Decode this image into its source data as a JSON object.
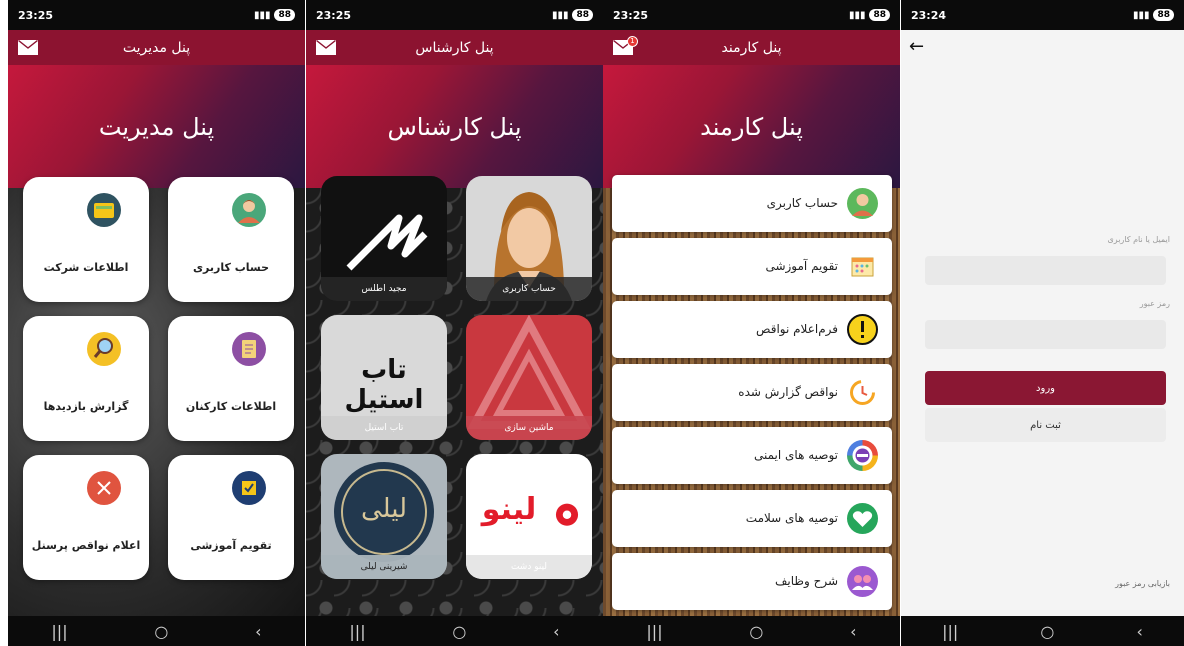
{
  "status_times": [
    "23:25",
    "23:25",
    "23:25",
    "23:24"
  ],
  "battery": "88",
  "colors": {
    "primary": "#8c1330",
    "hero_start": "#c5183c",
    "hero_end": "#2b1740",
    "login_btn": "#8a1733"
  },
  "nav_icons": [
    "recent-apps-icon",
    "home-icon",
    "back-icon"
  ],
  "admin": {
    "appbar_title": "پنل مدیریت",
    "hero_title": "پنل مدیریت",
    "tiles": [
      {
        "label": "حساب کاربری",
        "icon": "user-avatar-icon"
      },
      {
        "label": "اطلاعات شرکت",
        "icon": "folder-icon"
      },
      {
        "label": "اطلاعات کارکنان",
        "icon": "id-card-icon"
      },
      {
        "label": "گزارش بازدیدها",
        "icon": "magnifier-icon"
      },
      {
        "label": "تقویم آموزشی",
        "icon": "calendar-check-icon"
      },
      {
        "label": "اعلام نواقص پرسنل",
        "icon": "close-circle-icon"
      }
    ]
  },
  "expert": {
    "appbar_title": "پنل کارشناس",
    "hero_title": "پنل کارشناس",
    "cards": [
      {
        "label": "حساب کاربری",
        "icon": "woman-avatar-icon"
      },
      {
        "label": "مجید اطلس",
        "logo_text": ""
      },
      {
        "label": "ماشین سازی",
        "icon": "triangle-logo-icon"
      },
      {
        "label": "تاب استیل",
        "logo_text": "تاب استیل"
      },
      {
        "label": "لینو دشت",
        "logo_text": "لینو"
      },
      {
        "label": "شیرینی لیلی",
        "logo_text": "لیلی"
      }
    ]
  },
  "employee": {
    "appbar_title": "پنل کارمند",
    "hero_title": "پنل کارمند",
    "notification_count": "1",
    "rows": [
      {
        "label": "حساب کاربری",
        "icon": "user-avatar-icon"
      },
      {
        "label": "تقویم آموزشی",
        "icon": "calendar-icon"
      },
      {
        "label": "فرم‌اعلام نواقص",
        "icon": "warning-icon"
      },
      {
        "label": "نواقص گزارش شده",
        "icon": "clock-icon"
      },
      {
        "label": "توصیه های ایمنی",
        "icon": "hse-icon"
      },
      {
        "label": "توصیه های سلامت",
        "icon": "heart-icon"
      },
      {
        "label": "شرح وظایف",
        "icon": "team-icon"
      }
    ]
  },
  "login": {
    "username_label": "ایمیل یا نام کاربری",
    "username_value": "",
    "password_label": "رمز عبور",
    "password_value": "",
    "login_button": "ورود",
    "register_button": "ثبت نام",
    "forgot_link": "بازیابی رمز عبور"
  }
}
